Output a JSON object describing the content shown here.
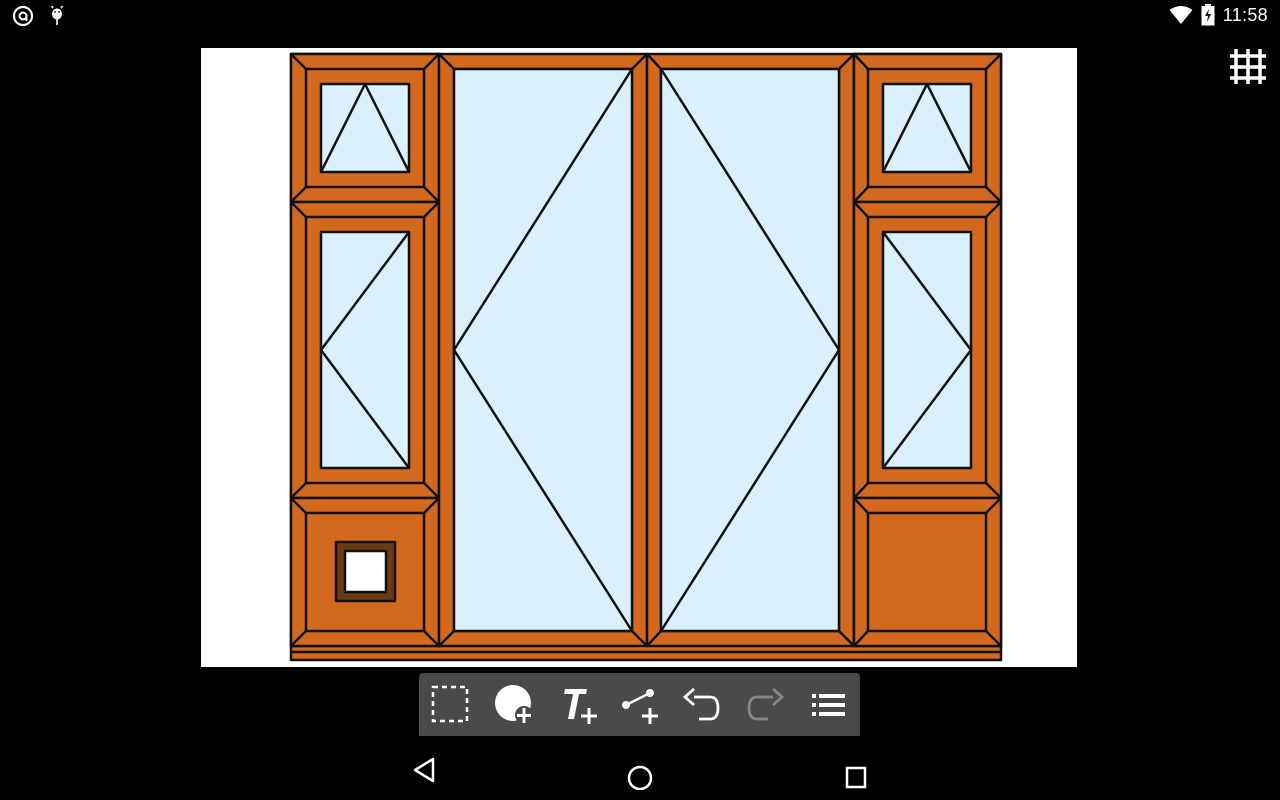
{
  "status_bar": {
    "time": "11:58",
    "left_icons": [
      "notification-app-icon",
      "android-debug-icon"
    ],
    "right_icons": [
      "wifi-icon",
      "battery-charging-icon"
    ]
  },
  "top_right": {
    "icon": "grid-icon"
  },
  "colors": {
    "frame_orange": "#D2691E",
    "glass_blue": "#DAF0FC",
    "outline": "#111111",
    "panel_white": "#FFFFFF",
    "handle_brown": "#6B3A12",
    "toolbar_bg": "#4A4A4A",
    "toolbar_icon": "#FFFFFF",
    "toolbar_icon_disabled": "#888888"
  },
  "toolbar": {
    "tools": [
      {
        "name": "select-rect-tool",
        "icon": "dashed-selection-icon",
        "enabled": true
      },
      {
        "name": "add-shape-tool",
        "icon": "circle-plus-icon",
        "enabled": true
      },
      {
        "name": "add-text-tool",
        "icon": "text-plus-icon",
        "enabled": true
      },
      {
        "name": "add-connector-tool",
        "icon": "line-plus-icon",
        "enabled": true
      },
      {
        "name": "undo-tool",
        "icon": "undo-icon",
        "enabled": true
      },
      {
        "name": "redo-tool",
        "icon": "redo-icon",
        "enabled": false
      },
      {
        "name": "menu-tool",
        "icon": "list-menu-icon",
        "enabled": true
      }
    ]
  },
  "nav_bar": {
    "buttons": [
      "back-icon",
      "home-icon",
      "recents-icon"
    ]
  }
}
